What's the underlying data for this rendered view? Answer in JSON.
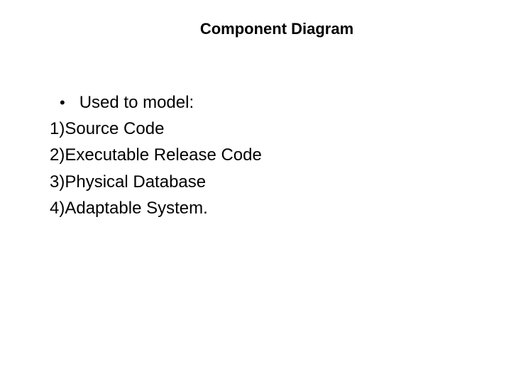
{
  "title": "Component Diagram",
  "bullet": {
    "marker": "•",
    "text": "Used to model:"
  },
  "items": [
    "1)Source Code",
    "2)Executable Release Code",
    "3)Physical Database",
    "4)Adaptable System."
  ]
}
